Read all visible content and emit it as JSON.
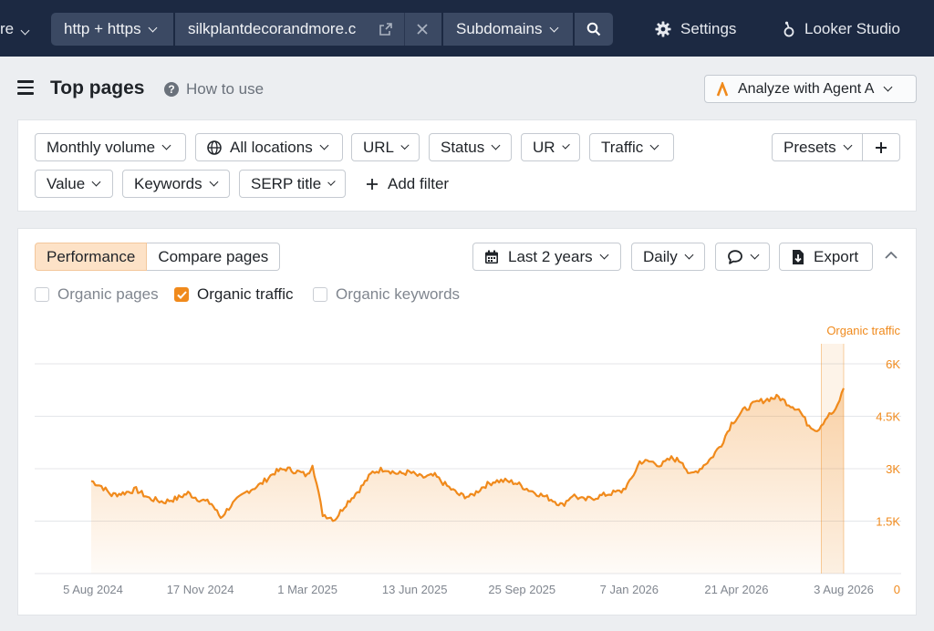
{
  "topbar": {
    "cut_text": "re",
    "protocol": "http + https",
    "domain": "silkplantdecorandmore.c",
    "mode": "Subdomains",
    "settings": "Settings",
    "looker": "Looker Studio"
  },
  "header": {
    "title": "Top pages",
    "how_to": "How to use",
    "agent_button": "Analyze with Agent A"
  },
  "filters": {
    "row1": [
      "Monthly volume",
      "All locations",
      "URL",
      "Status",
      "UR",
      "Traffic"
    ],
    "row2": [
      "Value",
      "Keywords",
      "SERP title"
    ],
    "add_filter": "Add filter",
    "presets": "Presets"
  },
  "chart_panel": {
    "tabs": [
      "Performance",
      "Compare pages"
    ],
    "period": "Last 2 years",
    "granularity": "Daily",
    "export": "Export",
    "metrics": [
      {
        "label": "Organic pages",
        "checked": false
      },
      {
        "label": "Organic traffic",
        "checked": true
      },
      {
        "label": "Organic keywords",
        "checked": false
      }
    ]
  },
  "colors": {
    "accent": "#f08a1c",
    "nav_bg": "#1c2942",
    "segment_bg": "#3b4963"
  },
  "chart_data": {
    "type": "area",
    "series": [
      {
        "name": "Organic traffic",
        "color": "#f08a1c"
      }
    ],
    "axis_title": "Organic traffic",
    "y_ticks": [
      "0",
      "1.5K",
      "3K",
      "4.5K",
      "6K"
    ],
    "ylim": [
      0,
      6000
    ],
    "x_ticks": [
      "5 Aug 2024",
      "17 Nov 2024",
      "1 Mar 2025",
      "13 Jun 2025",
      "25 Sep 2025",
      "7 Jan 2026",
      "21 Apr 2026",
      "3 Aug 2026"
    ],
    "x_range": [
      "2024-08-05",
      "2026-08-13"
    ],
    "forecast_start": "2026-07-22",
    "points": [
      [
        "2024-08-05",
        2650
      ],
      [
        "2024-08-15",
        2500
      ],
      [
        "2024-08-25",
        2250
      ],
      [
        "2024-09-05",
        2300
      ],
      [
        "2024-09-18",
        2400
      ],
      [
        "2024-10-01",
        2150
      ],
      [
        "2024-10-15",
        2050
      ],
      [
        "2024-10-28",
        2150
      ],
      [
        "2024-11-08",
        2300
      ],
      [
        "2024-11-17",
        2150
      ],
      [
        "2024-12-01",
        2000
      ],
      [
        "2024-12-10",
        1600
      ],
      [
        "2024-12-20",
        1950
      ],
      [
        "2025-01-05",
        2350
      ],
      [
        "2025-01-18",
        2550
      ],
      [
        "2025-02-01",
        2900
      ],
      [
        "2025-02-12",
        3000
      ],
      [
        "2025-02-25",
        2900
      ],
      [
        "2025-03-05",
        2800
      ],
      [
        "2025-03-10",
        3150
      ],
      [
        "2025-03-20",
        1700
      ],
      [
        "2025-04-01",
        1550
      ],
      [
        "2025-04-12",
        2000
      ],
      [
        "2025-04-25",
        2400
      ],
      [
        "2025-05-08",
        2900
      ],
      [
        "2025-05-20",
        3000
      ],
      [
        "2025-06-02",
        2850
      ],
      [
        "2025-06-13",
        2900
      ],
      [
        "2025-06-25",
        2750
      ],
      [
        "2025-07-08",
        2800
      ],
      [
        "2025-07-20",
        2500
      ],
      [
        "2025-08-01",
        2250
      ],
      [
        "2025-08-12",
        2200
      ],
      [
        "2025-08-25",
        2500
      ],
      [
        "2025-09-05",
        2650
      ],
      [
        "2025-09-15",
        2650
      ],
      [
        "2025-09-25",
        2600
      ],
      [
        "2025-10-08",
        2400
      ],
      [
        "2025-10-20",
        2250
      ],
      [
        "2025-11-01",
        2100
      ],
      [
        "2025-11-10",
        1950
      ],
      [
        "2025-11-20",
        2250
      ],
      [
        "2025-12-01",
        2100
      ],
      [
        "2025-12-15",
        2200
      ],
      [
        "2025-12-28",
        2300
      ],
      [
        "2026-01-07",
        2350
      ],
      [
        "2026-01-15",
        2600
      ],
      [
        "2026-01-25",
        3200
      ],
      [
        "2026-02-05",
        3200
      ],
      [
        "2026-02-15",
        3100
      ],
      [
        "2026-02-25",
        3300
      ],
      [
        "2026-03-08",
        3200
      ],
      [
        "2026-03-15",
        2800
      ],
      [
        "2026-03-25",
        3000
      ],
      [
        "2026-04-05",
        3300
      ],
      [
        "2026-04-15",
        3700
      ],
      [
        "2026-04-25",
        4300
      ],
      [
        "2026-05-08",
        4700
      ],
      [
        "2026-05-20",
        4900
      ],
      [
        "2026-06-01",
        5000
      ],
      [
        "2026-06-10",
        5050
      ],
      [
        "2026-06-20",
        4850
      ],
      [
        "2026-06-30",
        4700
      ],
      [
        "2026-07-08",
        4300
      ],
      [
        "2026-07-18",
        4100
      ],
      [
        "2026-07-28",
        4500
      ],
      [
        "2026-08-05",
        4650
      ],
      [
        "2026-08-13",
        5300
      ]
    ]
  }
}
